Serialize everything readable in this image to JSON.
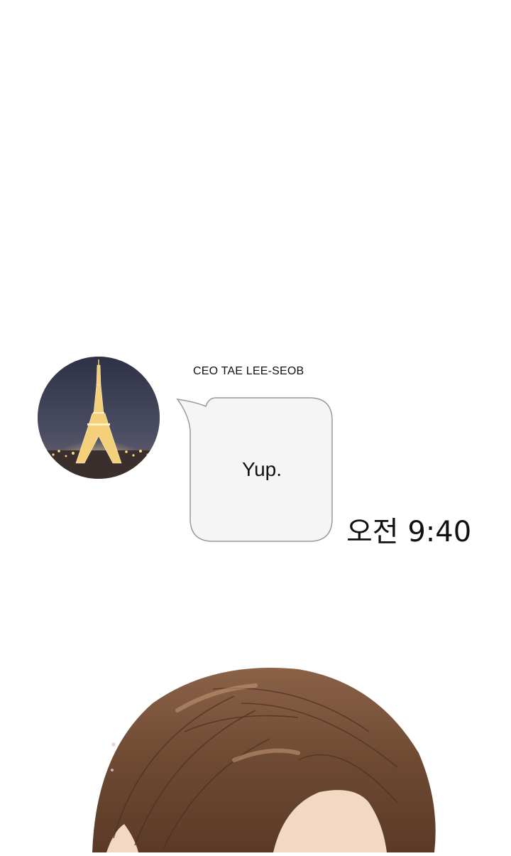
{
  "message": {
    "sender_name": "CEO TAE LEE-SEOB",
    "text": "Yup.",
    "timestamp": "오전 9:40"
  },
  "avatar": {
    "icon": "eiffel-tower-night-photo"
  },
  "colors": {
    "bubble_fill": "#f5f5f5",
    "bubble_border": "#9a9a9a",
    "hair": "#6e4a33",
    "skin": "#f3d9c4"
  }
}
